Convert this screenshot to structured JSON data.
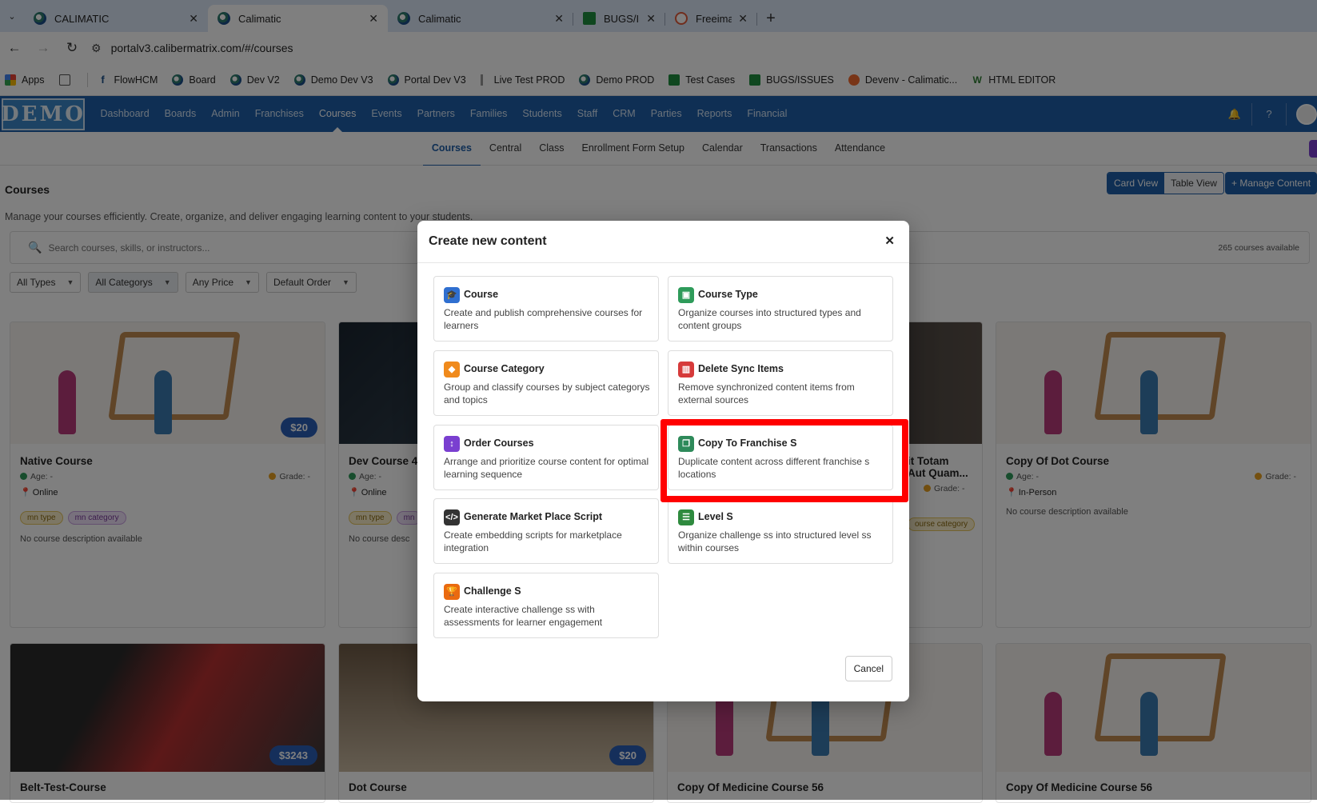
{
  "browser": {
    "tabs": [
      {
        "title": "CALIMATIC",
        "icon": "calimatic-icon"
      },
      {
        "title": "Calimatic",
        "icon": "calimatic-icon"
      },
      {
        "title": "Calimatic",
        "icon": "calimatic-icon"
      },
      {
        "title": "BUGS/ISS",
        "icon": "sheets-icon"
      },
      {
        "title": "Freeimag",
        "icon": "freeimages-icon"
      }
    ],
    "url": "portalv3.calibermatrix.com/#/courses",
    "bookmarks": [
      "Apps",
      "FlowHCM",
      "Board",
      "Dev V2",
      "Demo Dev V3",
      "Portal Dev V3",
      "Live Test PROD",
      "Demo PROD",
      "Test Cases",
      "BUGS/ISSUES",
      "Devenv - Calimatic...",
      "HTML EDITOR"
    ]
  },
  "app": {
    "logo": "DEMO",
    "nav": [
      "Dashboard",
      "Boards",
      "Admin",
      "Franchises",
      "Courses",
      "Events",
      "Partners",
      "Families",
      "Students",
      "Staff",
      "CRM",
      "Parties",
      "Reports",
      "Financial"
    ],
    "subnav": [
      "Courses",
      "Central",
      "Class",
      "Enrollment Form Setup",
      "Calendar",
      "Transactions",
      "Attendance"
    ]
  },
  "page": {
    "title": "Courses",
    "description": "Manage your courses efficiently. Create, organize, and deliver engaging learning content to your students.",
    "card_view": "Card View",
    "table_view": "Table View",
    "manage_content": "+ Manage Content",
    "search_placeholder": "Search courses, skills, or instructors...",
    "count": "265 courses available",
    "filters": [
      "All Types",
      "All Categorys",
      "Any Price",
      "Default Order"
    ]
  },
  "cards": [
    {
      "title": "Native Course",
      "age": "Age: -",
      "grade": "Grade: -",
      "location": "Online",
      "price": "$20",
      "tags": [
        "mn type",
        "mn category"
      ],
      "desc": "No course description available"
    },
    {
      "title": "Dev Course 45",
      "age": "Age: -",
      "location": "Online",
      "tags": [
        "mn type",
        "mn"
      ],
      "desc": "No course desc"
    },
    {
      "title": "it Totam",
      "title2": "Aut Quam...",
      "grade": "Grade: -",
      "tag": "ourse category"
    },
    {
      "title": "Copy Of Dot Course",
      "age": "Age: -",
      "grade": "Grade: -",
      "location": "In-Person",
      "desc": "No course description available"
    },
    {
      "title": "Belt-Test-Course",
      "price": "$3243"
    },
    {
      "title": "Dot Course",
      "price": "$20"
    },
    {
      "title": "Copy Of Medicine Course 56"
    },
    {
      "title": "Copy Of Medicine Course 56"
    }
  ],
  "modal": {
    "title": "Create new content",
    "cancel": "Cancel",
    "options": [
      {
        "name": "Course",
        "desc": "Create and publish comprehensive courses for learners",
        "color": "#2f6fd0",
        "icon": "graduation-cap-icon"
      },
      {
        "name": "Course Type",
        "desc": "Organize courses into structured types and content groups",
        "color": "#2e9b5a",
        "icon": "folder-icon"
      },
      {
        "name": "Course Category",
        "desc": "Group and classify courses by subject categorys and topics",
        "color": "#f08a1c",
        "icon": "tag-icon"
      },
      {
        "name": "Delete Sync Items",
        "desc": "Remove synchronized content items from external sources",
        "color": "#d63a3a",
        "icon": "trash-icon"
      },
      {
        "name": "Order Courses",
        "desc": "Arrange and prioritize course content for optimal learning sequence",
        "color": "#7a3fd0",
        "icon": "sort-icon"
      },
      {
        "name": "Copy To Franchise S",
        "desc": "Duplicate content across different franchise s locations",
        "color": "#2e8a5a",
        "icon": "copy-icon"
      },
      {
        "name": "Generate Market Place Script",
        "desc": "Create embedding scripts for marketplace integration",
        "color": "#333333",
        "icon": "code-icon"
      },
      {
        "name": "Level S",
        "desc": "Organize challenge ss into structured level ss within courses",
        "color": "#2e8a3e",
        "icon": "list-icon"
      },
      {
        "name": "Challenge S",
        "desc": "Create interactive challenge ss with assessments for learner engagement",
        "color": "#ea6a10",
        "icon": "trophy-icon"
      }
    ]
  }
}
